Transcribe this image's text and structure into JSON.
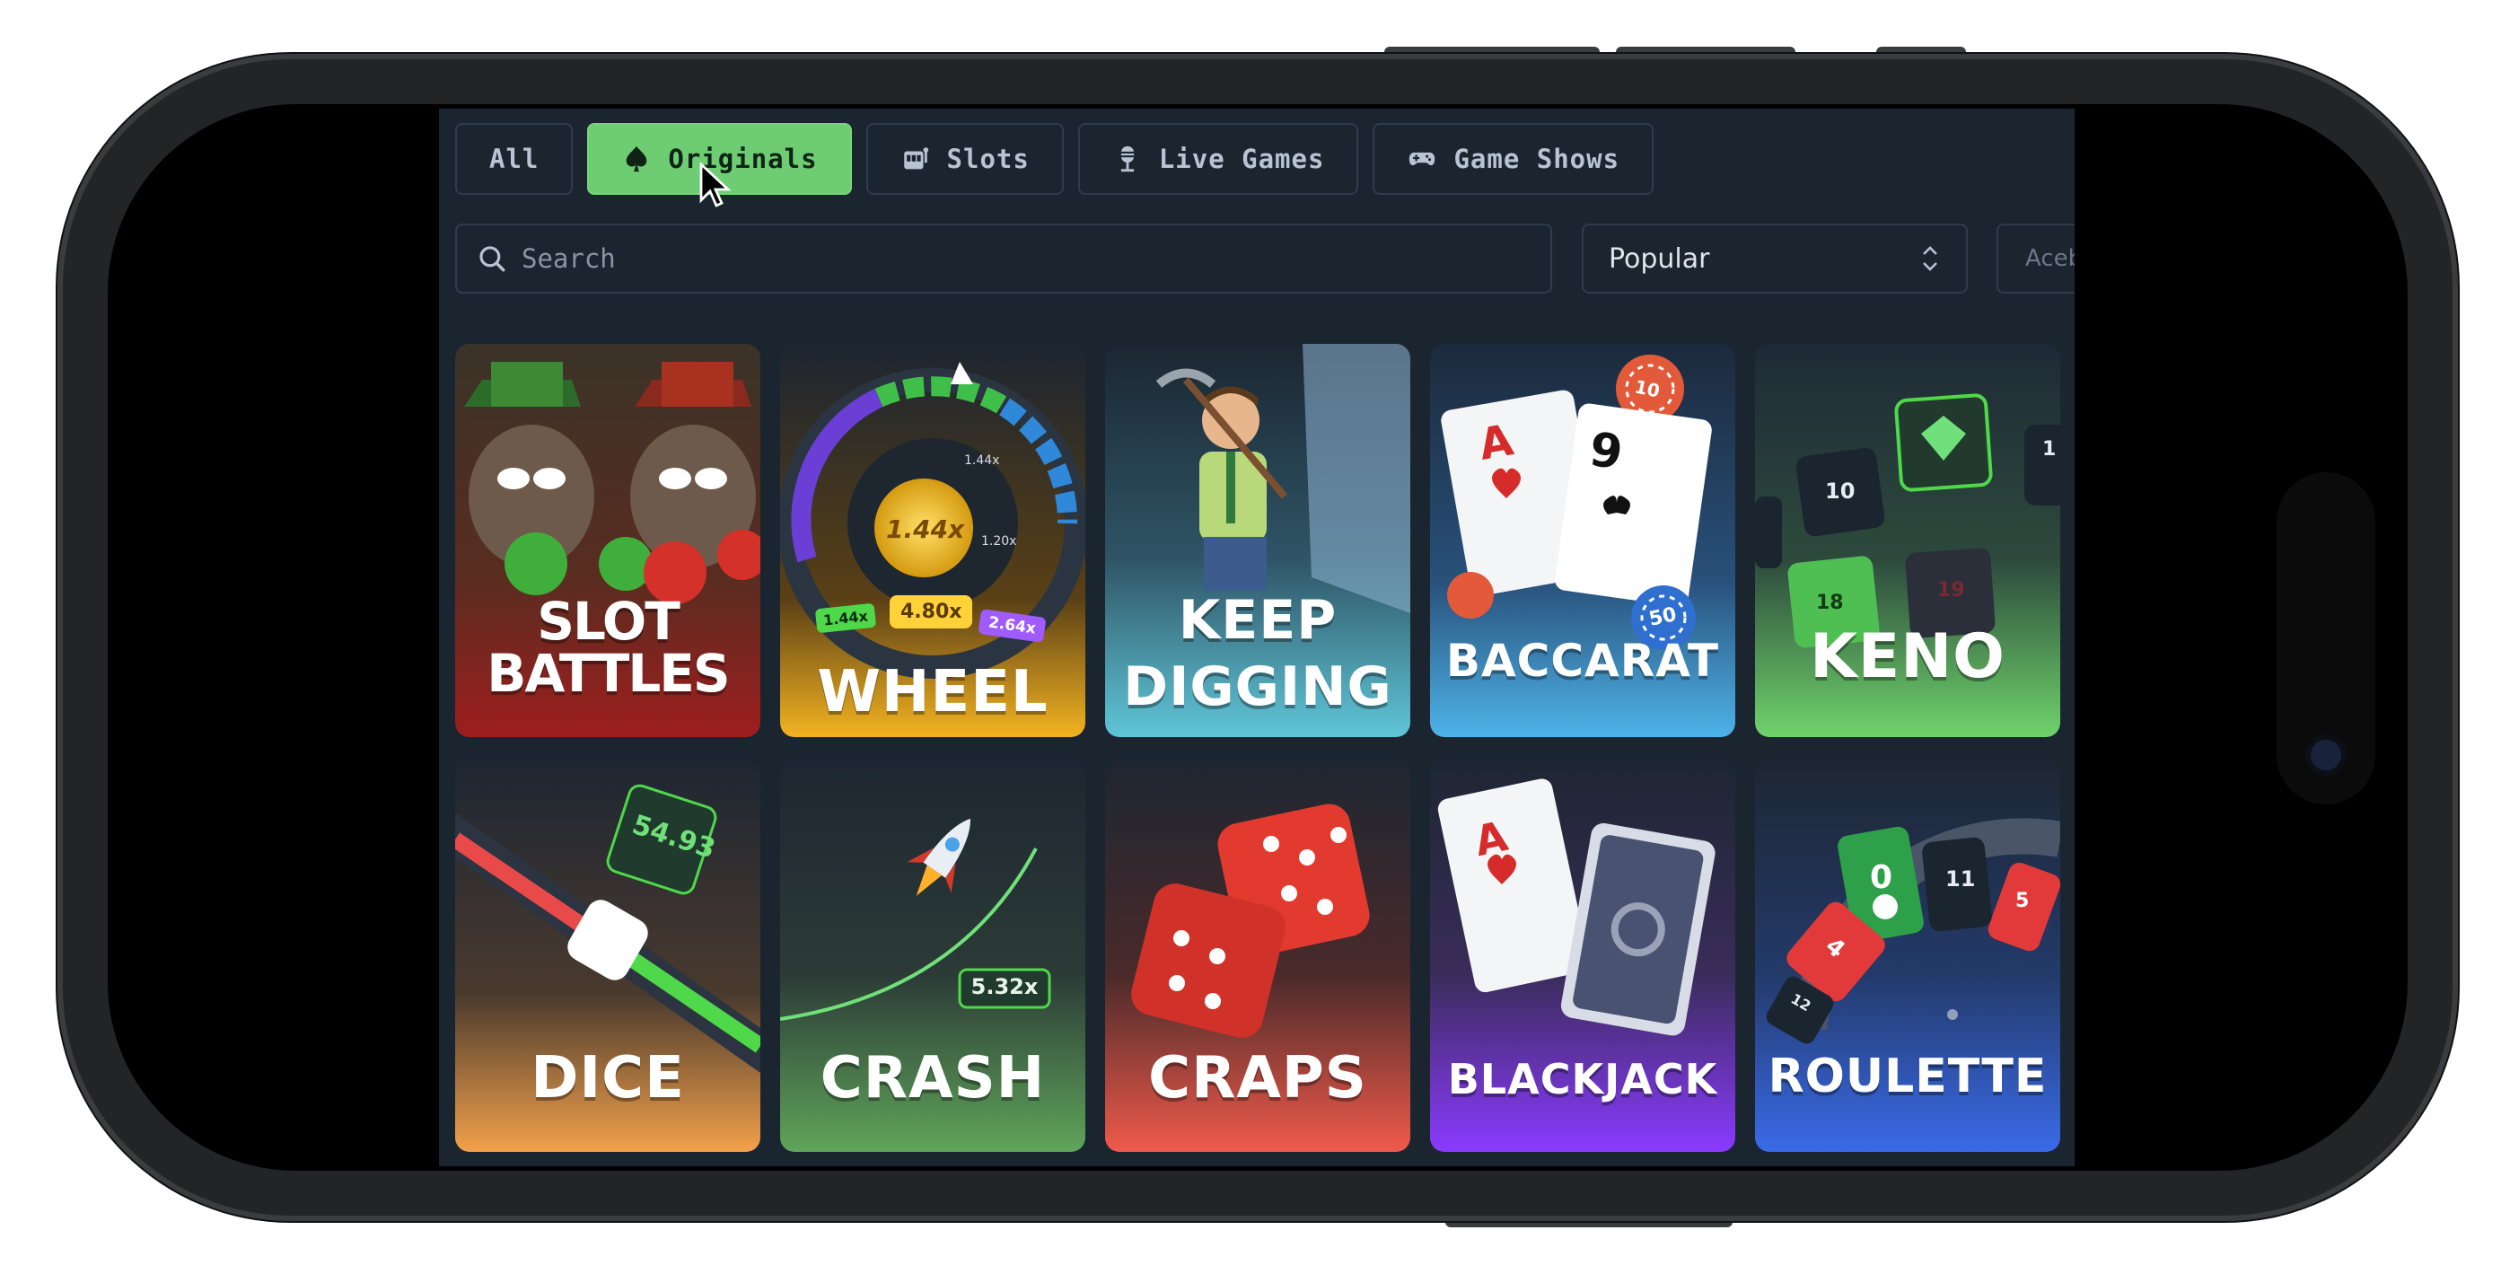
{
  "tabs": [
    {
      "label": "All",
      "icon": "none"
    },
    {
      "label": "Originals",
      "icon": "spade-icon",
      "active": true
    },
    {
      "label": "Slots",
      "icon": "slot-machine-icon"
    },
    {
      "label": "Live Games",
      "icon": "microphone-icon"
    },
    {
      "label": "Game Shows",
      "icon": "gamepad-icon"
    }
  ],
  "search": {
    "placeholder": "Search"
  },
  "sort": {
    "value": "Popular"
  },
  "provider": {
    "value": "Aceb"
  },
  "games": [
    {
      "title": "SLOT BATTLES"
    },
    {
      "title": "WHEEL",
      "multipliers": [
        "1.44x",
        "1.44x",
        "4.80x",
        "2.64x",
        "1.20x",
        "1.44x"
      ]
    },
    {
      "title_line1": "KEEP",
      "title_line2": "DIGGING"
    },
    {
      "title": "BACCARAT",
      "card1": "A",
      "card2": "9",
      "chip1": "10",
      "chip2": "50"
    },
    {
      "title": "KENO",
      "tiles": [
        "10",
        "18",
        "19",
        "1"
      ]
    },
    {
      "title": "DICE",
      "value": "54.93"
    },
    {
      "title": "CRASH",
      "multiplier": "5.32x"
    },
    {
      "title": "CRAPS"
    },
    {
      "title": "BLACKJACK",
      "card": "A"
    },
    {
      "title": "ROULETTE",
      "numbers": [
        "0",
        "4",
        "11",
        "5",
        "12"
      ]
    }
  ],
  "colors": {
    "accent": "#6ecd73",
    "background": "#1a2530",
    "border": "#2f3d4b"
  }
}
